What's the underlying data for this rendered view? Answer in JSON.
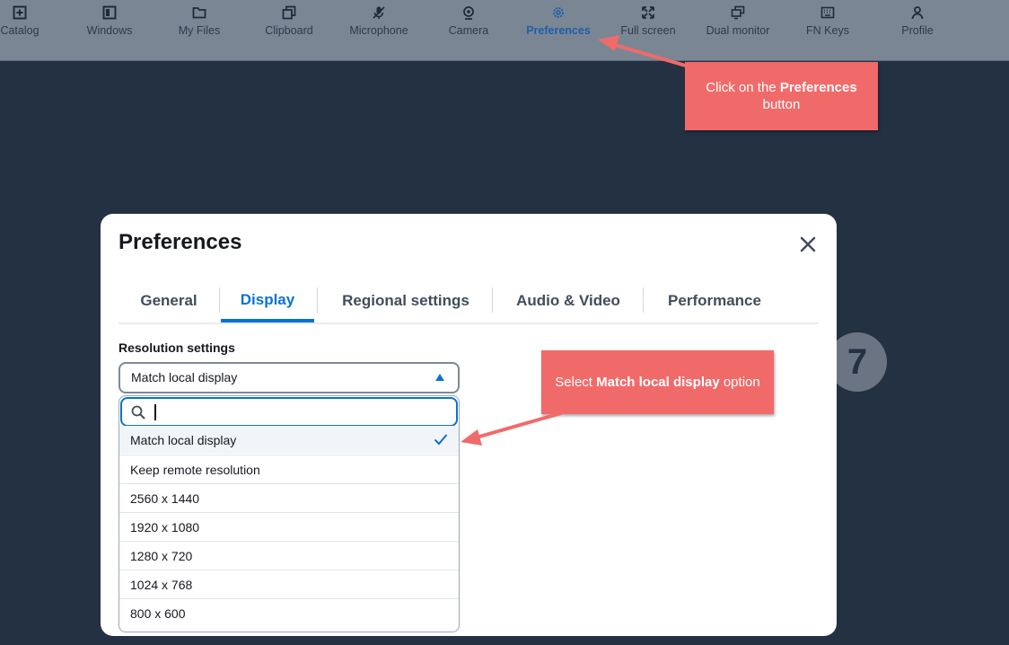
{
  "toolbar": {
    "items": [
      {
        "label": "Catalog",
        "icon": "plus-square-icon"
      },
      {
        "label": "Windows",
        "icon": "window-icon"
      },
      {
        "label": "My Files",
        "icon": "folder-icon"
      },
      {
        "label": "Clipboard",
        "icon": "clipboard-icon"
      },
      {
        "label": "Microphone",
        "icon": "microphone-muted-icon"
      },
      {
        "label": "Camera",
        "icon": "camera-icon"
      },
      {
        "label": "Preferences",
        "icon": "gear-icon",
        "active": true
      },
      {
        "label": "Full screen",
        "icon": "fullscreen-icon"
      },
      {
        "label": "Dual monitor",
        "icon": "dual-monitor-icon"
      },
      {
        "label": "FN Keys",
        "icon": "keyboard-icon"
      },
      {
        "label": "Profile",
        "icon": "user-icon"
      }
    ]
  },
  "callouts": {
    "preferences": {
      "before": "Click on the ",
      "bold": "Preferences",
      "after": "button"
    },
    "match_local": {
      "before": "Select ",
      "bold": "Match local display",
      "after": " option"
    }
  },
  "step_badge": "7",
  "dialog": {
    "title": "Preferences",
    "tabs": [
      "General",
      "Display",
      "Regional settings",
      "Audio & Video",
      "Performance"
    ],
    "active_tab": "Display",
    "resolution_label": "Resolution settings",
    "selected_value": "Match local display",
    "search_value": "",
    "options": [
      "Match local display",
      "Keep remote resolution",
      "2560 x 1440",
      "1920 x 1080",
      "1280 x 720",
      "1024 x 768",
      "800 x 600"
    ]
  },
  "colors": {
    "background": "#243143",
    "toolbar": "#7b8694",
    "accent": "#0972d3",
    "callout": "#f16a6a"
  }
}
